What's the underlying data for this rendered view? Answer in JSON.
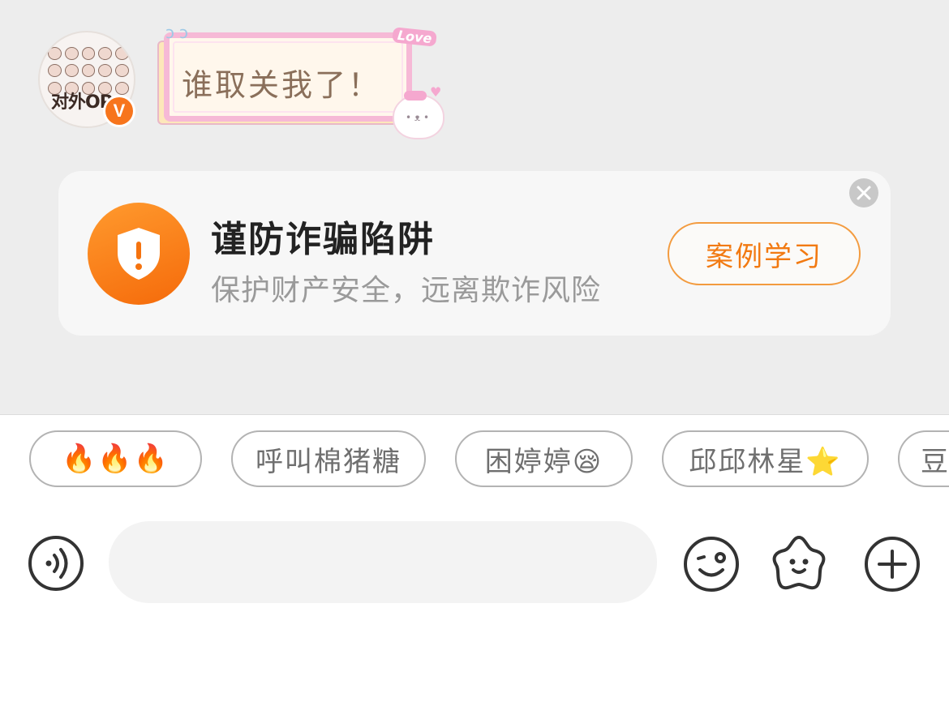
{
  "conversation": {
    "avatar": {
      "label": "对外OP",
      "icon": "avatar-image",
      "badge_text": "V",
      "badge_color": "#f7751d"
    },
    "message": {
      "text": "谁取关我了！",
      "decor_tag": "Love"
    }
  },
  "fraud_card": {
    "icon": "shield-alert-icon",
    "title": "谨防诈骗陷阱",
    "subtitle": "保护财产安全，远离欺诈风险",
    "button_label": "案例学习",
    "accent_color": "#f56a0a",
    "close_icon": "close-icon"
  },
  "quick_replies": [
    {
      "label": "🔥🔥🔥"
    },
    {
      "label": "呼叫棉猪糖"
    },
    {
      "label": "困婷婷😪"
    },
    {
      "label": "邱邱林星⭐"
    },
    {
      "label": "豆"
    }
  ],
  "input_bar": {
    "voice_icon": "voice-icon",
    "placeholder": "",
    "emoji_icon": "emoji-icon",
    "sticker_icon": "sticker-icon",
    "plus_icon": "plus-icon"
  }
}
